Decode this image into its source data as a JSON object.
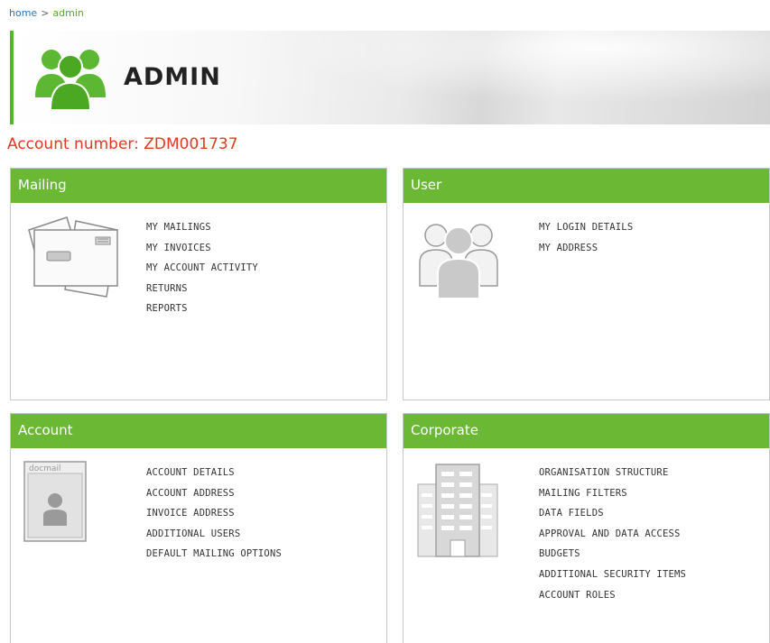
{
  "breadcrumb": {
    "home": "home",
    "separator": ">",
    "current": "admin"
  },
  "header": {
    "title": "ADMIN",
    "icon": "people-group-icon"
  },
  "account": {
    "number_label": "Account number: ZDM001737"
  },
  "colors": {
    "accent": "#6ab834",
    "account_number": "#e03a1e",
    "link": "#2a78b8"
  },
  "panels": {
    "mailing": {
      "title": "Mailing",
      "icon": "envelope-icon",
      "links": [
        "MY MAILINGS",
        "MY INVOICES",
        "MY ACCOUNT ACTIVITY",
        "RETURNS",
        "REPORTS"
      ]
    },
    "user": {
      "title": "User",
      "icon": "users-icon",
      "links": [
        "MY LOGIN DETAILS",
        "MY ADDRESS"
      ]
    },
    "account": {
      "title": "Account",
      "icon": "id-card-icon",
      "icon_text": "docmail",
      "links": [
        "ACCOUNT DETAILS",
        "ACCOUNT ADDRESS",
        "INVOICE ADDRESS",
        "ADDITIONAL USERS",
        "DEFAULT MAILING OPTIONS"
      ]
    },
    "corporate": {
      "title": "Corporate",
      "icon": "office-building-icon",
      "links": [
        "ORGANISATION STRUCTURE",
        "MAILING FILTERS",
        "DATA FIELDS",
        "APPROVAL AND DATA ACCESS",
        "BUDGETS",
        "ADDITIONAL SECURITY ITEMS",
        "ACCOUNT ROLES"
      ]
    }
  }
}
